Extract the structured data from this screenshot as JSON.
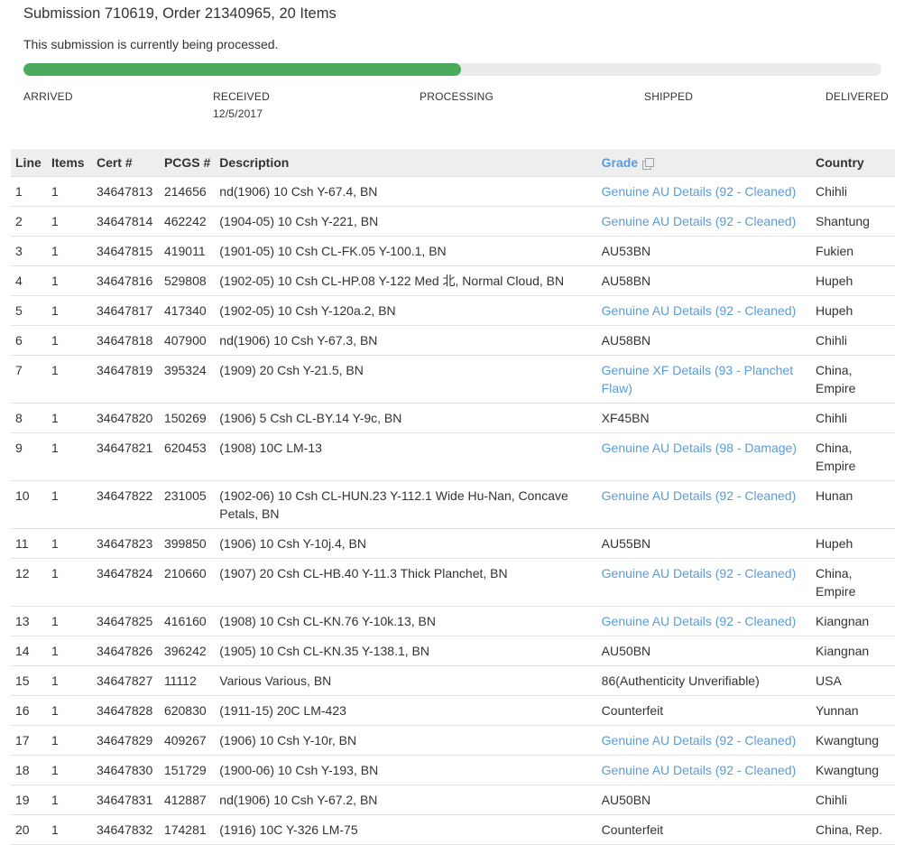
{
  "header": {
    "title": "Submission 710619, Order 21340965, 20 Items",
    "status_message": "This submission is currently being processed."
  },
  "progress": {
    "percent": 51,
    "fill_color": "#4caa5d",
    "stages": [
      {
        "label": "ARRIVED",
        "date": ""
      },
      {
        "label": "RECEIVED",
        "date": "12/5/2017"
      },
      {
        "label": "PROCESSING",
        "date": ""
      },
      {
        "label": "SHIPPED",
        "date": ""
      },
      {
        "label": "DELIVERED",
        "date": ""
      }
    ]
  },
  "table": {
    "columns": {
      "line": "Line",
      "items": "Items",
      "cert": "Cert #",
      "pcgs": "PCGS #",
      "description": "Description",
      "grade": "Grade",
      "country": "Country"
    },
    "link_color": "#5a9bd8",
    "rows": [
      {
        "line": "1",
        "items": "1",
        "cert": "34647813",
        "pcgs": "214656",
        "description": "nd(1906) 10 Csh Y-67.4, BN",
        "grade": "Genuine AU Details (92 - Cleaned)",
        "grade_link": true,
        "country": "Chihli"
      },
      {
        "line": "2",
        "items": "1",
        "cert": "34647814",
        "pcgs": "462242",
        "description": "(1904-05) 10 Csh Y-221, BN",
        "grade": "Genuine AU Details (92 - Cleaned)",
        "grade_link": true,
        "country": "Shantung"
      },
      {
        "line": "3",
        "items": "1",
        "cert": "34647815",
        "pcgs": "419011",
        "description": "(1901-05) 10 Csh CL-FK.05 Y-100.1, BN",
        "grade": "AU53BN",
        "grade_link": false,
        "country": "Fukien"
      },
      {
        "line": "4",
        "items": "1",
        "cert": "34647816",
        "pcgs": "529808",
        "description": "(1902-05) 10 Csh CL-HP.08 Y-122 Med 北, Normal Cloud, BN",
        "grade": "AU58BN",
        "grade_link": false,
        "country": "Hupeh"
      },
      {
        "line": "5",
        "items": "1",
        "cert": "34647817",
        "pcgs": "417340",
        "description": "(1902-05) 10 Csh Y-120a.2, BN",
        "grade": "Genuine AU Details (92 - Cleaned)",
        "grade_link": true,
        "country": "Hupeh"
      },
      {
        "line": "6",
        "items": "1",
        "cert": "34647818",
        "pcgs": "407900",
        "description": "nd(1906) 10 Csh Y-67.3, BN",
        "grade": "AU58BN",
        "grade_link": false,
        "country": "Chihli"
      },
      {
        "line": "7",
        "items": "1",
        "cert": "34647819",
        "pcgs": "395324",
        "description": "(1909) 20 Csh Y-21.5, BN",
        "grade": "Genuine XF Details (93 - Planchet Flaw)",
        "grade_link": true,
        "country": "China, Empire"
      },
      {
        "line": "8",
        "items": "1",
        "cert": "34647820",
        "pcgs": "150269",
        "description": "(1906) 5 Csh CL-BY.14 Y-9c, BN",
        "grade": "XF45BN",
        "grade_link": false,
        "country": "Chihli"
      },
      {
        "line": "9",
        "items": "1",
        "cert": "34647821",
        "pcgs": "620453",
        "description": "(1908) 10C LM-13",
        "grade": "Genuine AU Details (98 - Damage)",
        "grade_link": true,
        "country": "China, Empire"
      },
      {
        "line": "10",
        "items": "1",
        "cert": "34647822",
        "pcgs": "231005",
        "description": "(1902-06) 10 Csh CL-HUN.23 Y-112.1 Wide Hu-Nan, Concave Petals, BN",
        "grade": "Genuine AU Details (92 - Cleaned)",
        "grade_link": true,
        "country": "Hunan"
      },
      {
        "line": "11",
        "items": "1",
        "cert": "34647823",
        "pcgs": "399850",
        "description": "(1906) 10 Csh Y-10j.4, BN",
        "grade": "AU55BN",
        "grade_link": false,
        "country": "Hupeh"
      },
      {
        "line": "12",
        "items": "1",
        "cert": "34647824",
        "pcgs": "210660",
        "description": "(1907) 20 Csh CL-HB.40 Y-11.3 Thick Planchet, BN",
        "grade": "Genuine AU Details (92 - Cleaned)",
        "grade_link": true,
        "country": "China, Empire"
      },
      {
        "line": "13",
        "items": "1",
        "cert": "34647825",
        "pcgs": "416160",
        "description": "(1908) 10 Csh CL-KN.76 Y-10k.13, BN",
        "grade": "Genuine AU Details (92 - Cleaned)",
        "grade_link": true,
        "country": "Kiangnan"
      },
      {
        "line": "14",
        "items": "1",
        "cert": "34647826",
        "pcgs": "396242",
        "description": "(1905) 10 Csh CL-KN.35 Y-138.1, BN",
        "grade": "AU50BN",
        "grade_link": false,
        "country": "Kiangnan"
      },
      {
        "line": "15",
        "items": "1",
        "cert": "34647827",
        "pcgs": "11112",
        "description": "Various Various, BN",
        "grade": "86(Authenticity Unverifiable)",
        "grade_link": false,
        "country": "USA"
      },
      {
        "line": "16",
        "items": "1",
        "cert": "34647828",
        "pcgs": "620830",
        "description": "(1911-15) 20C LM-423",
        "grade": "Counterfeit",
        "grade_link": false,
        "country": "Yunnan"
      },
      {
        "line": "17",
        "items": "1",
        "cert": "34647829",
        "pcgs": "409267",
        "description": "(1906) 10 Csh Y-10r, BN",
        "grade": "Genuine AU Details (92 - Cleaned)",
        "grade_link": true,
        "country": "Kwangtung"
      },
      {
        "line": "18",
        "items": "1",
        "cert": "34647830",
        "pcgs": "151729",
        "description": "(1900-06) 10 Csh Y-193, BN",
        "grade": "Genuine AU Details (92 - Cleaned)",
        "grade_link": true,
        "country": "Kwangtung"
      },
      {
        "line": "19",
        "items": "1",
        "cert": "34647831",
        "pcgs": "412887",
        "description": "nd(1906) 10 Csh Y-67.2, BN",
        "grade": "AU50BN",
        "grade_link": false,
        "country": "Chihli"
      },
      {
        "line": "20",
        "items": "1",
        "cert": "34647832",
        "pcgs": "174281",
        "description": "(1916) 10C Y-326 LM-75",
        "grade": "Counterfeit",
        "grade_link": false,
        "country": "China, Rep."
      }
    ]
  }
}
